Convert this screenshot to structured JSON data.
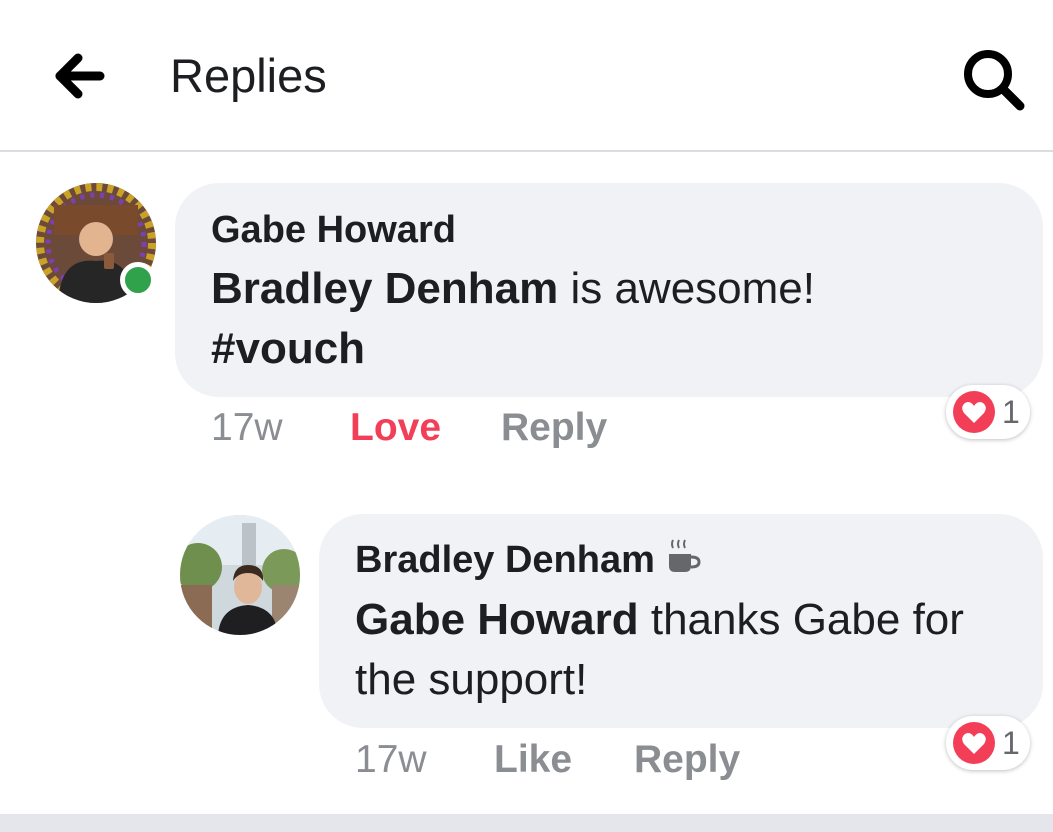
{
  "header": {
    "title": "Replies",
    "back_icon": "arrow-left-icon",
    "search_icon": "search-icon"
  },
  "comments": [
    {
      "author": "Gabe Howard",
      "online": true,
      "mention": "Bradley Denham",
      "text_after_mention": " is awesome!",
      "line2": "#vouch",
      "timestamp": "17w",
      "reaction_action": "Love",
      "reply_label": "Reply",
      "reaction_count": "1",
      "reaction_icon": "heart-icon"
    },
    {
      "author": "Bradley Denham",
      "author_badge_icon": "coffee-cup-icon",
      "mention": "Gabe Howard",
      "text_after_mention": " thanks Gabe for",
      "line2": "the support!",
      "timestamp": "17w",
      "reaction_action": "Like",
      "reply_label": "Reply",
      "reaction_count": "1",
      "reaction_icon": "heart-icon"
    }
  ],
  "colors": {
    "love": "#f33e58",
    "online": "#31a24c",
    "bubble": "#f0f2f5",
    "meta": "#8a8d91"
  }
}
